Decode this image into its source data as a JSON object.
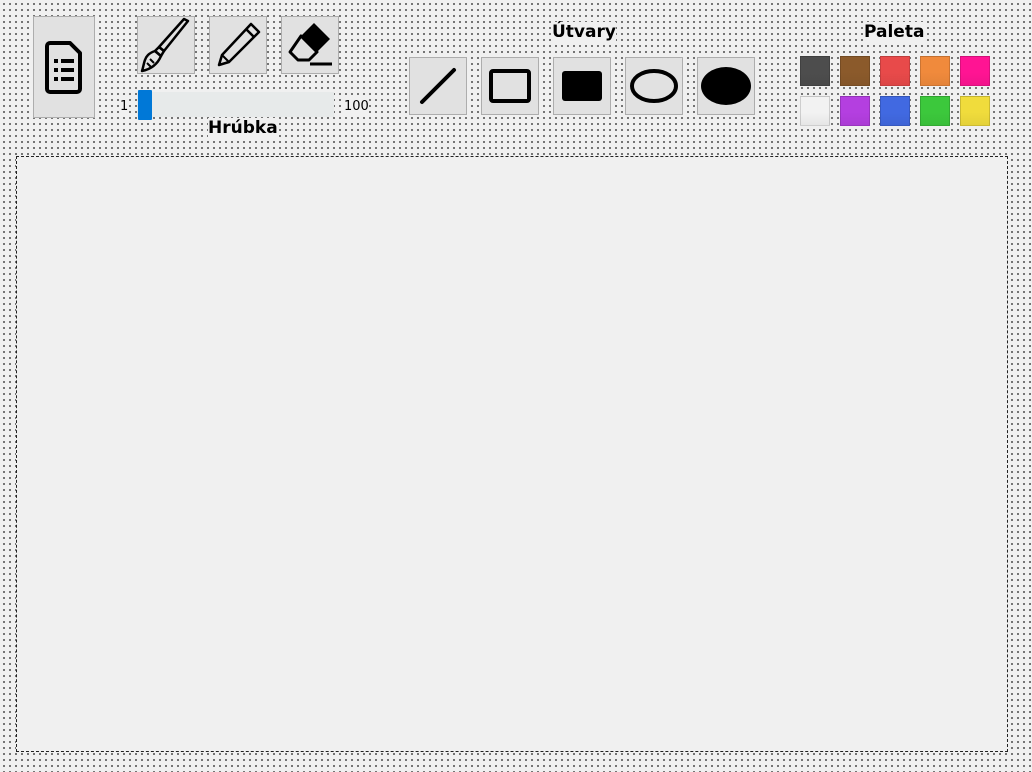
{
  "toolbar": {
    "file_button_icon": "document-list-icon",
    "tools": [
      {
        "name": "brush",
        "icon": "brush-icon"
      },
      {
        "name": "pencil",
        "icon": "pencil-icon"
      },
      {
        "name": "eraser",
        "icon": "eraser-icon"
      }
    ],
    "thickness": {
      "label": "Hrúbka",
      "min_label": "1",
      "max_label": "100",
      "value": 1
    }
  },
  "shapes": {
    "label": "Útvary",
    "items": [
      {
        "name": "line",
        "icon": "line-icon"
      },
      {
        "name": "rectangle",
        "icon": "rectangle-outline-icon"
      },
      {
        "name": "filled-rectangle",
        "icon": "rectangle-filled-icon"
      },
      {
        "name": "ellipse",
        "icon": "ellipse-outline-icon"
      },
      {
        "name": "filled-ellipse",
        "icon": "ellipse-filled-icon"
      }
    ]
  },
  "palette": {
    "label": "Paleta",
    "colors": [
      [
        "#4d4d4d",
        "#8b5a2b",
        "#e84a4a",
        "#f08a3c",
        "#ff1493"
      ],
      [
        "#f2f2f2",
        "#b43fe0",
        "#4169e1",
        "#3cc83c",
        "#f0dc3c"
      ]
    ]
  }
}
